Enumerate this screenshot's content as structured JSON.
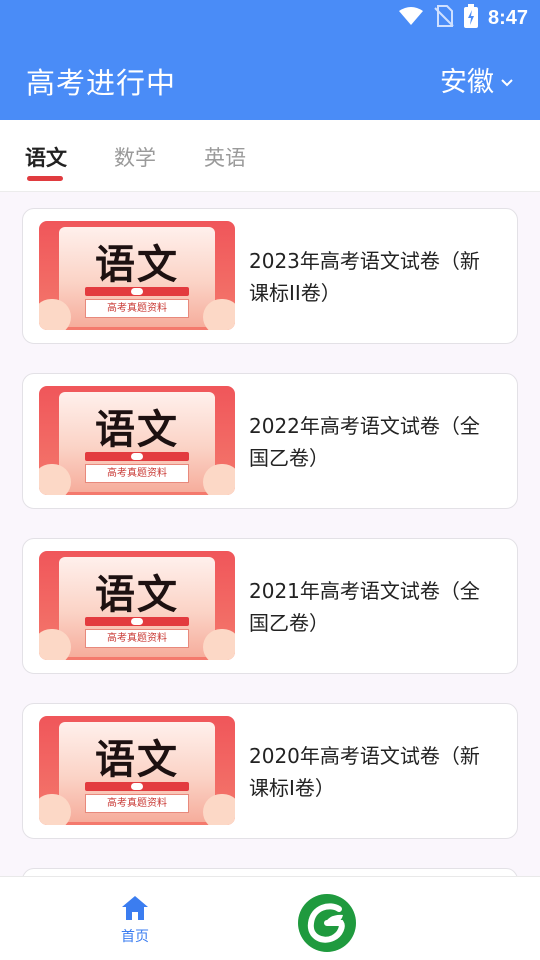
{
  "status_bar": {
    "time": "8:47"
  },
  "header": {
    "title": "高考进行中",
    "region": "安徽"
  },
  "tabs": [
    {
      "label": "语文",
      "active": true
    },
    {
      "label": "数学",
      "active": false
    },
    {
      "label": "英语",
      "active": false
    }
  ],
  "cards": [
    {
      "title": "2023年高考语文试卷（新课标II卷）",
      "thumb_big": "语文",
      "thumb_sub": "高考真题资料"
    },
    {
      "title": "2022年高考语文试卷（全国乙卷）",
      "thumb_big": "语文",
      "thumb_sub": "高考真题资料"
    },
    {
      "title": "2021年高考语文试卷（全国乙卷）",
      "thumb_big": "语文",
      "thumb_sub": "高考真题资料"
    },
    {
      "title": "2020年高考语文试卷（新课标I卷）",
      "thumb_big": "语文",
      "thumb_sub": "高考真题资料"
    }
  ],
  "bottom_nav": {
    "home_label": "首页"
  },
  "colors": {
    "brand_blue": "#4a8cf7",
    "active_tab_red": "#e03b3f",
    "nav_blue": "#3b7df0",
    "logo_green": "#1f9a3e"
  }
}
